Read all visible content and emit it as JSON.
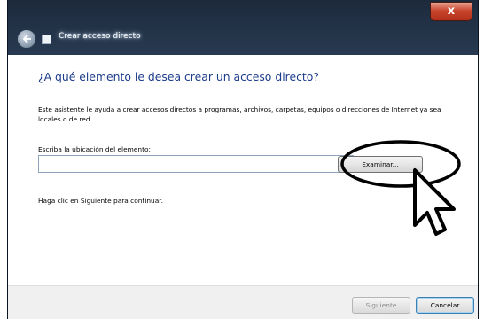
{
  "window": {
    "title": "Crear acceso directo",
    "close_label": "x"
  },
  "content": {
    "heading": "¿A qué elemento le desea crear un acceso directo?",
    "description": "Este asistente le ayuda a crear accesos directos a programas, archivos, carpetas, equipos o direcciones de Internet ya sea locales o de red.",
    "location_label": "Escriba la ubicación del elemento:",
    "location_value": "",
    "browse_label": "Examinar...",
    "hint": "Haga clic en Siguiente para continuar."
  },
  "footer": {
    "next_label": "Siguiente",
    "cancel_label": "Cancelar"
  },
  "icons": {
    "back": "back-arrow-icon",
    "shortcut": "shortcut-icon",
    "cursor": "mouse-pointer-icon"
  },
  "colors": {
    "heading": "#1c3c8c",
    "close": "#c8452c",
    "annotation": "#000000"
  }
}
